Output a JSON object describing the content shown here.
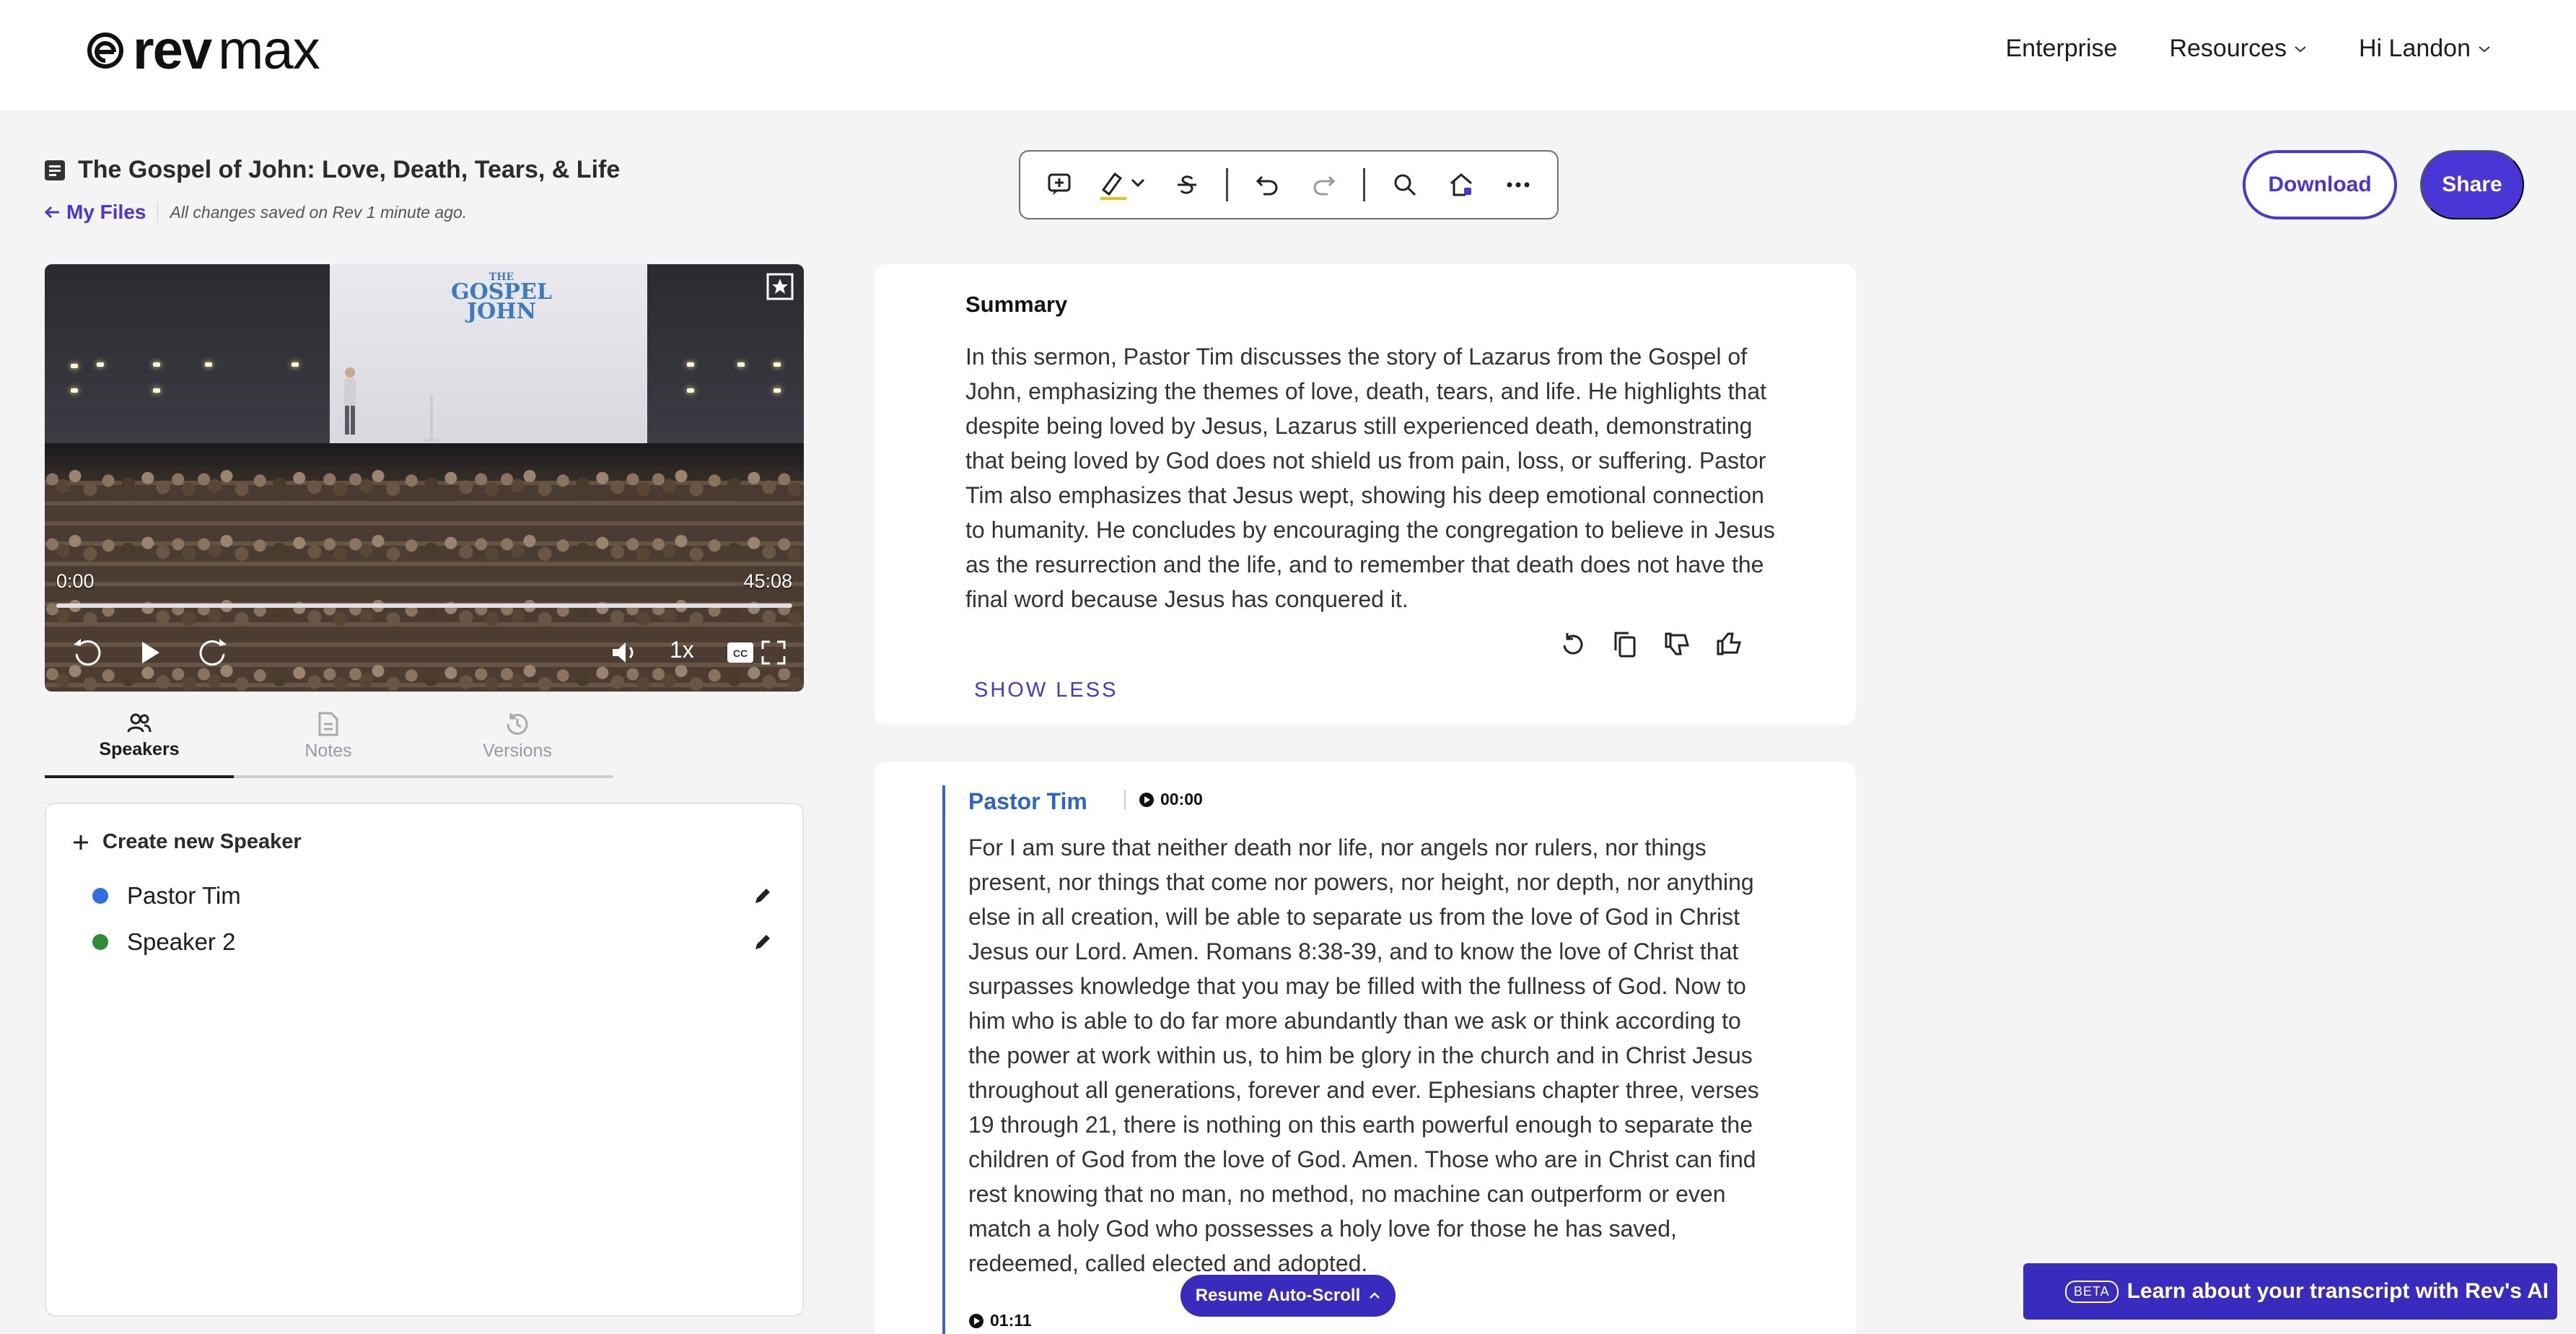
{
  "brand": {
    "rev": "rev",
    "max": "max"
  },
  "nav": {
    "enterprise": "Enterprise",
    "resources": "Resources",
    "user": "Hi Landon"
  },
  "document": {
    "title": "The Gospel of John: Love, Death, Tears, & Life",
    "back_label": "My Files",
    "save_status": "All changes saved on Rev 1 minute ago."
  },
  "actions": {
    "download": "Download",
    "share": "Share"
  },
  "video": {
    "current_time": "0:00",
    "duration": "45:08",
    "speed": "1x",
    "screen_text_line1": "THE",
    "screen_text_line2": "GOSPEL",
    "screen_text_line3": "JOHN"
  },
  "tabs": [
    {
      "label": "Speakers"
    },
    {
      "label": "Notes"
    },
    {
      "label": "Versions"
    }
  ],
  "speakers": {
    "create_label": "Create new Speaker",
    "items": [
      {
        "name": "Pastor Tim",
        "color": "#2f6fe0"
      },
      {
        "name": "Speaker 2",
        "color": "#2e8b3a"
      }
    ]
  },
  "summary": {
    "title": "Summary",
    "text": "In this sermon, Pastor Tim discusses the story of Lazarus from the Gospel of John, emphasizing the themes of love, death, tears, and life. He highlights that despite being loved by Jesus, Lazarus still experienced death, demonstrating that being loved by God does not shield us from pain, loss, or suffering. Pastor Tim also emphasizes that Jesus wept, showing his deep emotional connection to humanity. He concludes by encouraging the congregation to believe in Jesus as the resurrection and the life, and to remember that death does not have the final word because Jesus has conquered it.",
    "show_less": "SHOW LESS"
  },
  "transcript": {
    "speaker": "Pastor Tim",
    "timestamp": "00:00",
    "text": "For I am sure that neither death nor life, nor angels nor rulers, nor things present, nor things that come nor powers, nor height, nor depth, nor anything else in all creation, will be able to separate us from the love of God in Christ Jesus our Lord. Amen. Romans 8:38-39, and to know the love of Christ that surpasses knowledge that you may be filled with the fullness of God. Now to him who is able to do far more abundantly than we ask or think according to the power at work within us, to him be glory in the church and in Christ Jesus throughout all generations, forever and ever. Ephesians chapter three, verses 19 through 21, there is nothing on this earth powerful enough to separate the children of God from the love of God. Amen. Those who are in Christ can find rest knowing that no man, no method, no machine can outperform or even match a holy God who possesses a holy love for those he has saved, redeemed, called elected and adopted.",
    "next_timestamp": "01:11"
  },
  "resume_scroll": "Resume Auto-Scroll",
  "ai_banner": {
    "beta": "BETA",
    "text": "Learn about your transcript with Rev's AI"
  },
  "colors": {
    "accent": "#4a35d6",
    "speaker_blue": "#2f64cf"
  }
}
